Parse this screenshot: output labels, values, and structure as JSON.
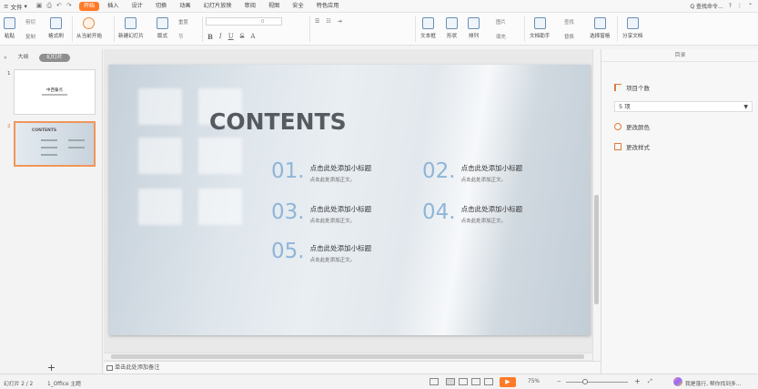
{
  "menu": {
    "file_label": "文件",
    "tabs": [
      "开始",
      "插入",
      "设计",
      "切换",
      "动画",
      "幻灯片放映",
      "审阅",
      "视图",
      "安全",
      "特色应用"
    ],
    "active_tab": "开始",
    "search_label": "Q 查找命令..."
  },
  "ribbon": {
    "paste": "粘贴",
    "cut": "剪切",
    "copy": "复制",
    "format_painter": "格式刷",
    "play_from_current": "从当前开始",
    "new_slide": "新建幻灯片",
    "layout": "版式",
    "reset": "重置",
    "section": "节",
    "font_size": "0",
    "textbox": "文本框",
    "shape": "形状",
    "arrange": "排列",
    "picture": "图片",
    "fill": "填充",
    "text_to_slides": "文档助手",
    "find": "查找",
    "replace": "替换",
    "select_pane": "选择窗格",
    "share_doc": "分享文档"
  },
  "left_panel": {
    "tabs": [
      "大纲",
      "幻灯片"
    ],
    "selected_tab": "幻灯片",
    "slide1_num": "1",
    "slide1_title": "中西餐点",
    "slide2_num": "2",
    "slide2_title": "CONTENTS",
    "add_symbol": "+"
  },
  "slide": {
    "title": "CONTENTS",
    "items": [
      {
        "num": "01.",
        "title": "点击此处添加小标题",
        "sub": "点击此处添加正文。"
      },
      {
        "num": "02.",
        "title": "点击此处添加小标题",
        "sub": "点击此处添加正文。"
      },
      {
        "num": "03.",
        "title": "点击此处添加小标题",
        "sub": "点击此处添加正文。"
      },
      {
        "num": "04.",
        "title": "点击此处添加小标题",
        "sub": "点击此处添加正文。"
      },
      {
        "num": "05.",
        "title": "点击此处添加小标题",
        "sub": "点击此处添加正文。"
      }
    ]
  },
  "notes": {
    "placeholder": "单击此处添加备注"
  },
  "right_panel": {
    "header": "目录",
    "items_count_label": "项目个数",
    "count_value": "5 项",
    "change_color": "更改颜色",
    "change_style": "更改样式"
  },
  "status": {
    "slide_counter": "幻灯片 2 / 2",
    "theme": "1_Office 主题",
    "zoom": "75%",
    "minus": "−",
    "plus": "+",
    "assistant": "我是蓬行, 帮你找到多..."
  },
  "colors": {
    "accent": "#ff7a28",
    "number_blue": "#8fb5d8"
  }
}
